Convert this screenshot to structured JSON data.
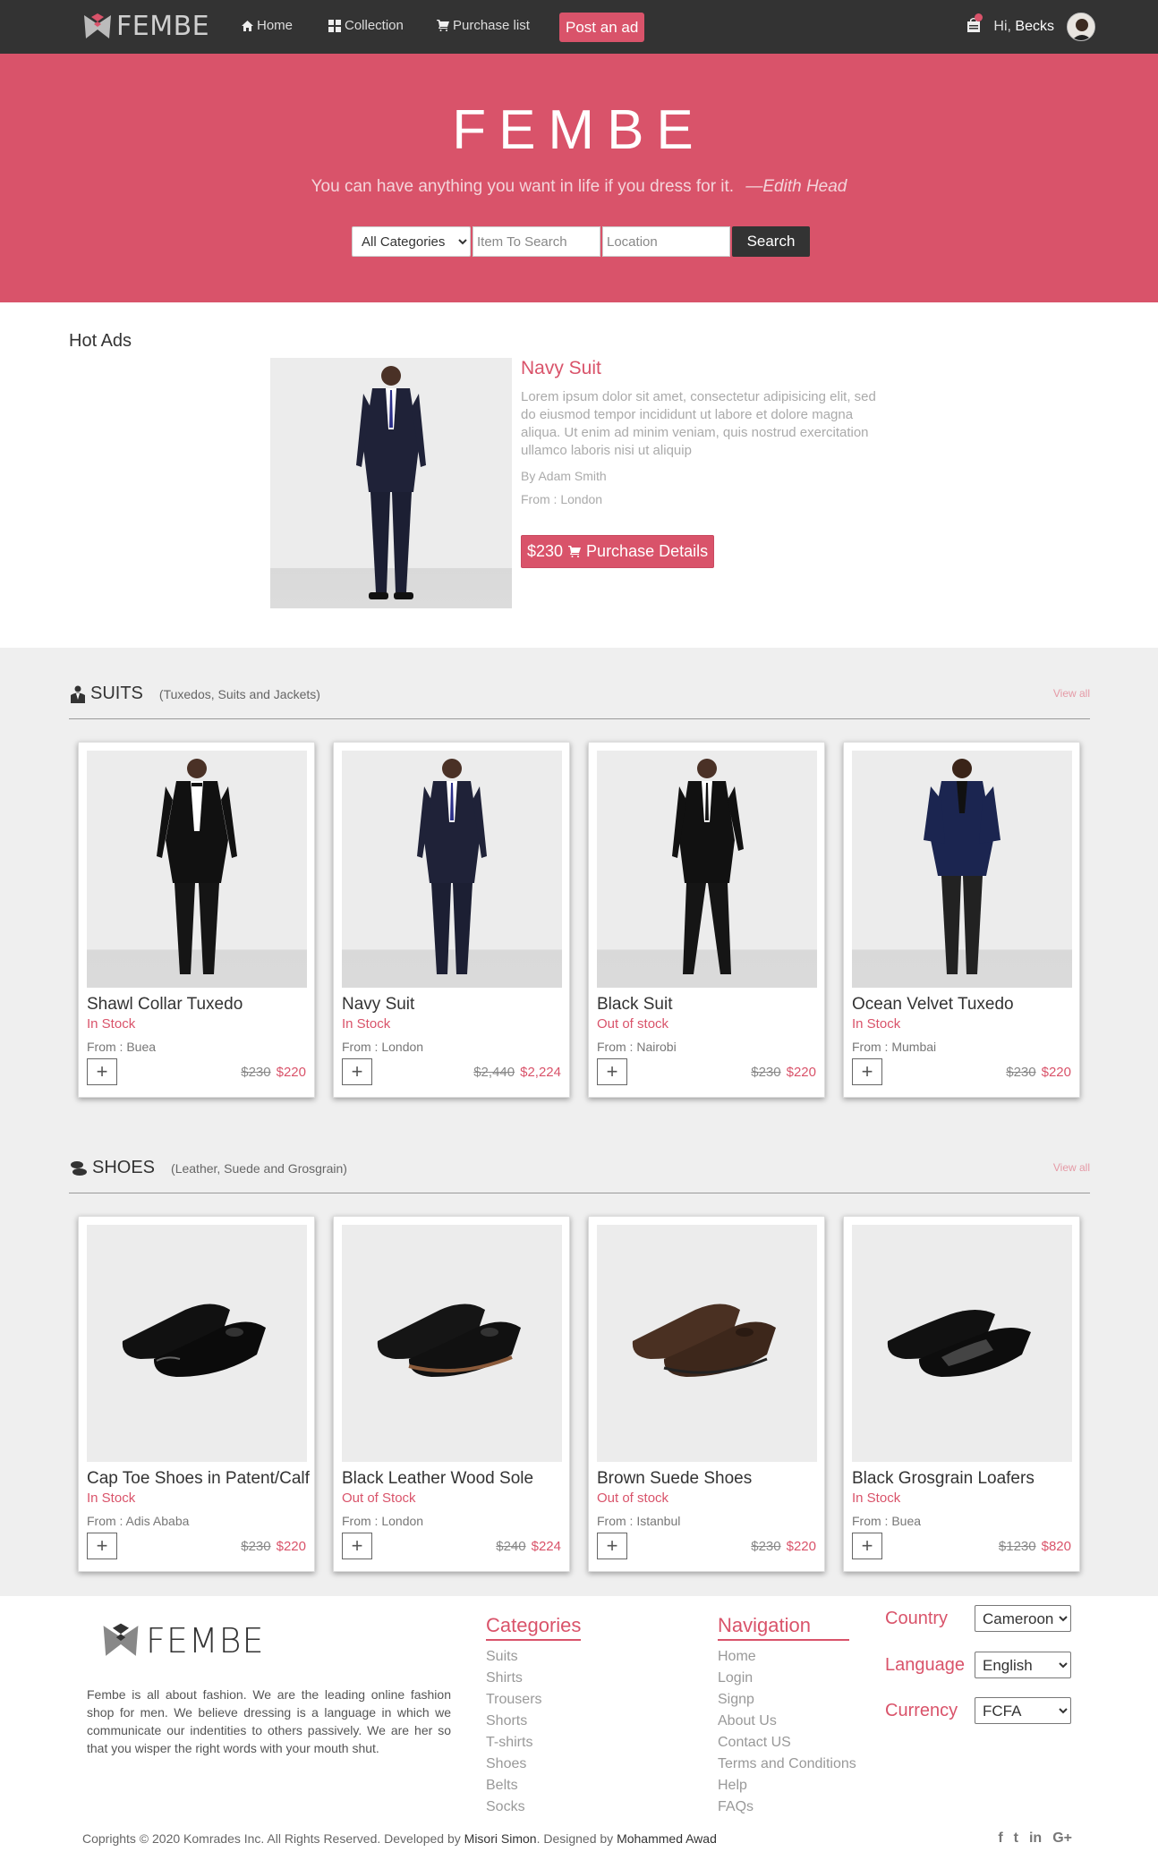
{
  "brand": {
    "name": "FEMBE"
  },
  "nav": {
    "items": [
      {
        "label": "Home",
        "icon": "home-icon"
      },
      {
        "label": "Collection",
        "icon": "grid-icon"
      },
      {
        "label": "Purchase list",
        "icon": "cart-icon"
      }
    ],
    "post_ad_label": "Post an ad",
    "greeting_prefix": "Hi,",
    "user_name": "Becks"
  },
  "hero": {
    "title": "FEMBE",
    "quote": "You can have anything you want in life if you dress for it.",
    "quote_author": "—Edith Head",
    "search": {
      "category_selected": "All Categories",
      "item_placeholder": "Item To Search",
      "location_placeholder": "Location",
      "button_label": "Search"
    }
  },
  "hot_ads": {
    "heading": "Hot Ads",
    "item": {
      "name": "Navy Suit",
      "description": "Lorem ipsum dolor sit amet, consectetur adipisicing elit, sed do eiusmod tempor incididunt ut labore et dolore magna aliqua. Ut enim ad minim veniam, quis nostrud exercitation ullamco laboris nisi ut aliquip",
      "author": "By Adam Smith",
      "from": "From : London",
      "price": "$230",
      "button_label": "Purchase Details"
    }
  },
  "suits": {
    "title": "SUITS",
    "subtitle": "(Tuxedos, Suits and Jackets)",
    "view_all": "View all",
    "items": [
      {
        "name": "Shawl Collar Tuxedo",
        "stock": "In Stock",
        "from": "From : Buea",
        "old_price": "$230",
        "price": "$220"
      },
      {
        "name": "Navy Suit",
        "stock": "In Stock",
        "from": "From : London",
        "old_price": "$2,440",
        "price": "$2,224"
      },
      {
        "name": "Black Suit",
        "stock": "Out of stock",
        "from": "From : Nairobi",
        "old_price": "$230",
        "price": "$220"
      },
      {
        "name": "Ocean Velvet Tuxedo",
        "stock": "In Stock",
        "from": "From : Mumbai",
        "old_price": "$230",
        "price": "$220"
      }
    ]
  },
  "shoes": {
    "title": "SHOES",
    "subtitle": "(Leather, Suede and Grosgrain)",
    "view_all": "View all",
    "items": [
      {
        "name": "Cap Toe Shoes in Patent/Calf",
        "stock": "In Stock",
        "from": "From : Adis Ababa",
        "old_price": "$230",
        "price": "$220"
      },
      {
        "name": "Black Leather Wood Sole",
        "stock": "Out of Stock",
        "from": "From : London",
        "old_price": "$240",
        "price": "$224"
      },
      {
        "name": "Brown Suede Shoes",
        "stock": "Out of stock",
        "from": "From : Istanbul",
        "old_price": "$230",
        "price": "$220"
      },
      {
        "name": "Black Grosgrain Loafers",
        "stock": "In Stock",
        "from": "From : Buea",
        "old_price": "$1230",
        "price": "$820"
      }
    ]
  },
  "footer": {
    "brand": "FEMBE",
    "about": "Fembe is all about fashion. We are the leading online fashion shop for men. We believe dressing is a language in which we communicate our indentities to others passively. We are her so that you wisper the right words with your mouth shut.",
    "categories": {
      "heading": "Categories",
      "items": [
        "Suits",
        "Shirts",
        "Trousers",
        "Shorts",
        "T-shirts",
        "Shoes",
        "Belts",
        "Socks"
      ]
    },
    "navigation": {
      "heading": "Navigation",
      "items": [
        "Home",
        "Login",
        "Signp",
        "About Us",
        "Contact US",
        "Terms and Conditions",
        "Help",
        "FAQs"
      ]
    },
    "settings": {
      "country_label": "Country",
      "country_value": "Cameroon",
      "language_label": "Language",
      "language_value": "English",
      "currency_label": "Currency",
      "currency_value": "FCFA"
    },
    "copyright_prefix": "Coprights © 2020 Komrades Inc. All Rights Reserved. Developed by",
    "developer": "Misori Simon",
    "designed_by_prefix": ". Designed by",
    "designer": "Mohammed Awad",
    "socials": [
      "f",
      "t",
      "in",
      "G+"
    ]
  },
  "colors": {
    "accent": "#d9536a",
    "navbar": "#333333",
    "section_bg": "#efefef"
  }
}
